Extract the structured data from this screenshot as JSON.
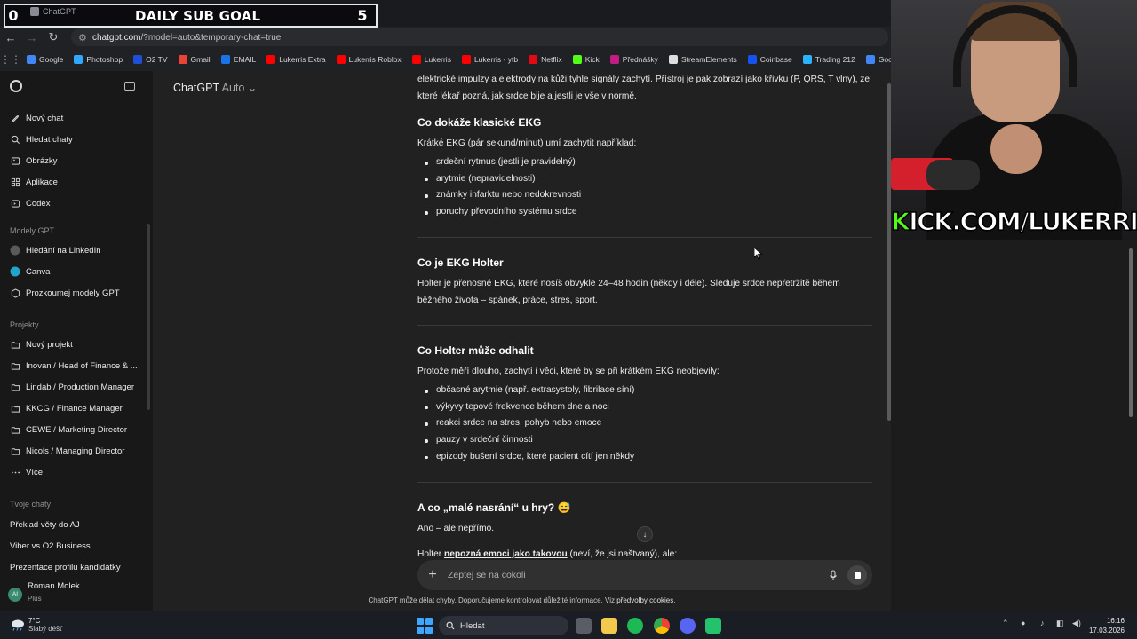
{
  "overlay": {
    "sub_goal_left": "0",
    "sub_goal_title": "DAILY SUB GOAL",
    "sub_goal_right": "5",
    "tab_title": "ChatGPT",
    "kick_prefix": "K",
    "kick_rest": "ICK.COM/LUKERRIS"
  },
  "browser": {
    "url_host": "chatgpt.com",
    "url_path": "/?model=auto&temporary-chat=true",
    "bookmarks": [
      {
        "label": "Google",
        "color": "#4285f4"
      },
      {
        "label": "Photoshop",
        "color": "#31a8ff"
      },
      {
        "label": "O2 TV",
        "color": "#1f4fd8"
      },
      {
        "label": "Gmail",
        "color": "#ea4335"
      },
      {
        "label": "EMAIL",
        "color": "#1a73e8"
      },
      {
        "label": "Lukerris Extra",
        "color": "#ff0000"
      },
      {
        "label": "Lukerris Roblox",
        "color": "#ff0000"
      },
      {
        "label": "Lukerris",
        "color": "#ff0000"
      },
      {
        "label": "Lukerris - ytb",
        "color": "#ff0000"
      },
      {
        "label": "Netflix",
        "color": "#e50914"
      },
      {
        "label": "Kick",
        "color": "#53fc18"
      },
      {
        "label": "Přednášky",
        "color": "#c21d83"
      },
      {
        "label": "StreamElements",
        "color": "#dddddd"
      },
      {
        "label": "Coinbase",
        "color": "#1652f0"
      },
      {
        "label": "Trading 212",
        "color": "#2bb3ff"
      },
      {
        "label": "Google Gem",
        "color": "#4285f4"
      }
    ]
  },
  "sidebar": {
    "items": [
      {
        "label": "Nový chat",
        "icon": "edit-icon"
      },
      {
        "label": "Hledat chaty",
        "icon": "search-icon"
      },
      {
        "label": "Obrázky",
        "icon": "image-icon"
      },
      {
        "label": "Aplikace",
        "icon": "apps-icon"
      },
      {
        "label": "Codex",
        "icon": "code-icon"
      }
    ],
    "gpts_header": "Modely GPT",
    "gpts": [
      {
        "label": "Hledání na LinkedIn"
      },
      {
        "label": "Canva"
      },
      {
        "label": "Prozkoumej modely GPT"
      }
    ],
    "projects_header": "Projekty",
    "projects": [
      {
        "label": "Nový projekt"
      },
      {
        "label": "Inovan / Head of Finance & ..."
      },
      {
        "label": "Lindab / Production Manager"
      },
      {
        "label": "KKCG / Finance Manager"
      },
      {
        "label": "CEWE / Marketing Director"
      },
      {
        "label": "Nicols / Managing Director"
      },
      {
        "label": "Více"
      }
    ],
    "chats_header": "Tvoje chaty",
    "chats": [
      "Překlad věty do AJ",
      "Viber vs O2 Business",
      "Prezentace profilu kandidátky"
    ],
    "user": {
      "initials": "AI",
      "name": "Roman Molek",
      "plan": "Plus"
    }
  },
  "main": {
    "model_name": "ChatGPT",
    "model_mode": "Auto",
    "intro_text": "elektrické impulzy a elektrody na kůži tyhle signály zachytí. Přístroj je pak zobrazí jako křivku (P, QRS, T vlny), ze které lékař pozná, jak srdce bije a jestli je vše v normě.",
    "sec1_title": "Co dokáže klasické EKG",
    "sec1_lead": "Krátké EKG (pár sekund/minut) umí zachytit například:",
    "sec1_items": [
      "srdeční rytmus (jestli je pravidelný)",
      "arytmie (nepravidelnosti)",
      "známky infarktu nebo nedokrevnosti",
      "poruchy převodního systému srdce"
    ],
    "sec2_title": "Co je EKG Holter",
    "sec2_text": "Holter je přenosné EKG, které nosíš obvykle 24–48 hodin (někdy i déle). Sleduje srdce nepřetržitě během běžného života – spánek, práce, stres, sport.",
    "sec3_title": "Co Holter může odhalit",
    "sec3_lead": "Protože měří dlouho, zachytí i věci, které by se při krátkém EKG neobjevily:",
    "sec3_items": [
      "občasné arytmie (např. extrasystoly, fibrilace síní)",
      "výkyvy tepové frekvence během dne a noci",
      "reakci srdce na stres, pohyb nebo emoce",
      "pauzy v srdeční činnosti",
      "epizody bušení srdce, které pacient cítí jen někdy"
    ],
    "sec4_title": "A co „malé nasrání“ u hry? 😅",
    "sec4_text": "Ano – ale nepřímo.",
    "sec4_partial_bold": "nepozná emoci jako takovou",
    "sec4_partial_pre": "Holter ",
    "sec4_partial_post": " (neví, že jsi naštvaný), ale:",
    "composer_placeholder": "Zeptej se na cokoli",
    "disclaimer_pre": "ChatGPT může dělat chyby. Doporučujeme kontrolovat důležité informace. Viz ",
    "disclaimer_link": "předvolby cookies",
    "disclaimer_post": "."
  },
  "taskbar": {
    "weather_temp": "7°C",
    "weather_desc": "Slabý déšť",
    "search_label": "Hledat",
    "time": "16:16",
    "date": "17.03.2026"
  },
  "colors": {
    "accent_green": "#53fc18",
    "sidebar_bg": "#181818",
    "main_bg": "#212121"
  }
}
